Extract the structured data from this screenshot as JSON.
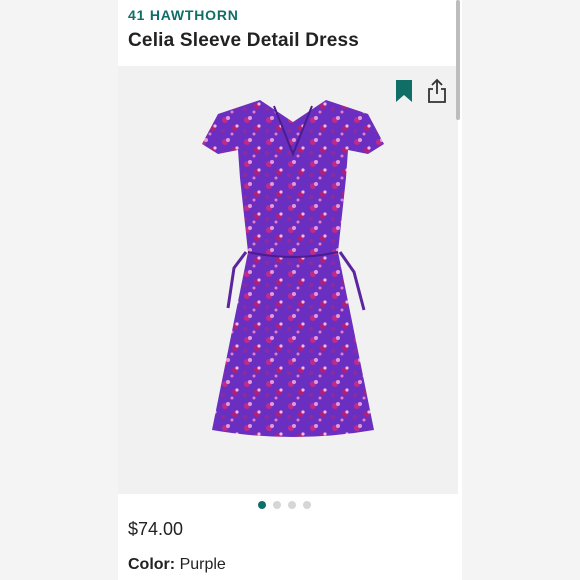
{
  "product": {
    "brand": "41 HAWTHORN",
    "title": "Celia Sleeve Detail Dress",
    "price": "$74.00",
    "color_label": "Color:",
    "color_value": "Purple"
  },
  "gallery": {
    "dot_count": 4,
    "active_index": 0
  },
  "icons": {
    "bookmark": "bookmark-icon",
    "share": "share-icon"
  },
  "colors": {
    "accent": "#0f6e66",
    "dress_primary": "#6a2fc0",
    "dress_accent": "#c02a8a"
  }
}
